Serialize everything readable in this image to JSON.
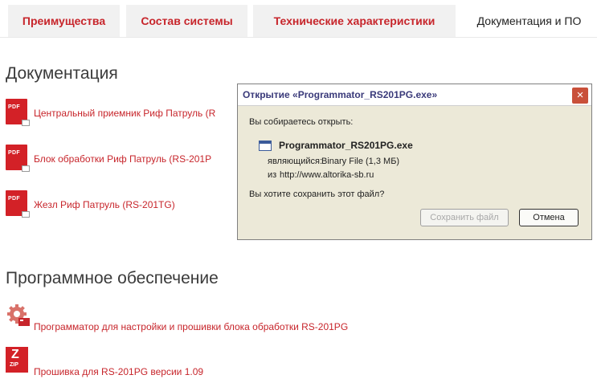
{
  "tabs": [
    {
      "label": "Преимущества"
    },
    {
      "label": "Состав системы"
    },
    {
      "label": "Технические характеристики"
    },
    {
      "label": "Документация и ПО"
    }
  ],
  "documentation": {
    "heading": "Документация",
    "items": [
      {
        "icon_text": "PDF",
        "label": "Центральный приемник Риф Патруль (R"
      },
      {
        "icon_text": "PDF",
        "label": "Блок обработки Риф Патруль (RS-201P"
      },
      {
        "icon_text": "PDF",
        "label": "Жезл Риф Патруль (RS-201TG)"
      }
    ]
  },
  "software": {
    "heading": "Программное обеспечение",
    "items": [
      {
        "icon": "gear-icon",
        "label": "Программатор для настройки и прошивки блока обработки RS-201PG"
      },
      {
        "icon": "zip-icon",
        "icon_text_big": "Z",
        "icon_text": "ZIP",
        "label": "Прошивка для RS-201PG версии 1.09"
      }
    ]
  },
  "dialog": {
    "title": "Открытие «Programmator_RS201PG.exe»",
    "close_symbol": "×",
    "intro": "Вы собираетесь открыть:",
    "filename": "Programmator_RS201PG.exe",
    "type_prefix": "являющийся:",
    "type_value": "Binary File (1,3 МБ)",
    "source_prefix": "из",
    "source_value": "http://www.altorika-sb.ru",
    "question": "Вы хотите сохранить этот файл?",
    "save_label": "Сохранить файл",
    "cancel_label": "Отмена"
  },
  "colors": {
    "accent": "#c7252b",
    "icon_red": "#d32127",
    "dialog_bg": "#ece9d8"
  }
}
